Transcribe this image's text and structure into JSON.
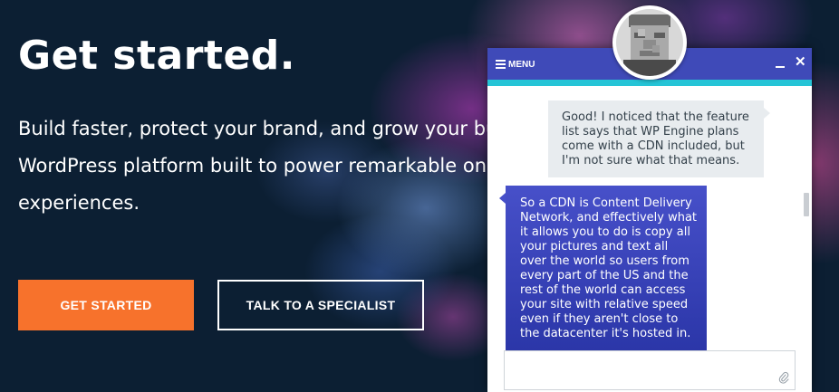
{
  "hero": {
    "title": "Get started.",
    "description": "Build faster, protect your brand, and grow your busi WordPress platform built to power remarkable onlin experiences.",
    "primary_button": "GET STARTED",
    "secondary_button": "TALK TO A SPECIALIST"
  },
  "chat": {
    "menu_label": "MENU",
    "close_glyph": "✕",
    "messages": [
      {
        "from": "user",
        "text": "Good! I noticed that the feature list says that WP Engine plans come with a CDN included, but I'm not sure what that means."
      },
      {
        "from": "agent",
        "text": "So a CDN is Content Delivery Network, and effectively what it allows you to do is copy all your pictures and text all over the world so users from every part of the US and the rest of the world can access your site with relative speed even if they aren't close to the datacenter it's hosted in."
      }
    ],
    "input_placeholder": ""
  },
  "colors": {
    "background": "#0c1f33",
    "primary_button": "#f7722c",
    "chat_header": "#3f4ab8",
    "chat_accent": "#25c4d6",
    "agent_bubble": "#3a44b8",
    "user_bubble": "#e8ecef"
  },
  "icons": [
    "hamburger-icon",
    "minimize-icon",
    "close-icon",
    "paperclip-icon",
    "agent-avatar"
  ]
}
